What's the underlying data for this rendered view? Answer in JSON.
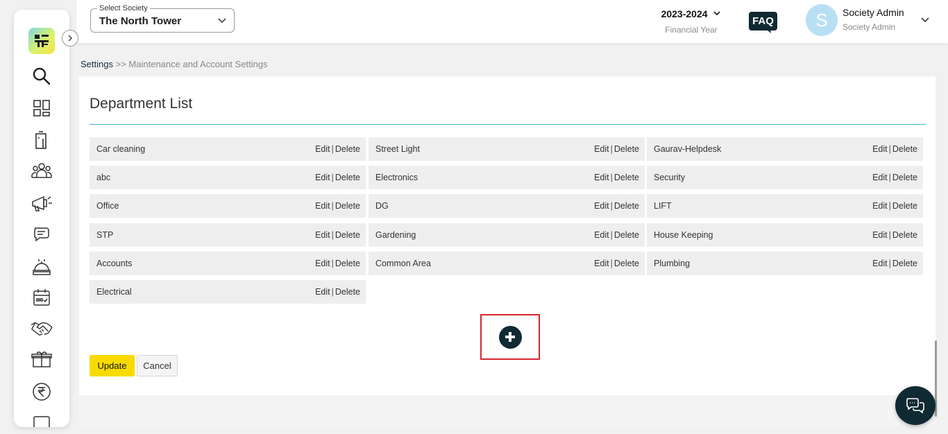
{
  "header": {
    "society_label": "Select Society",
    "society_value": "The North Tower",
    "financial_year_value": "2023-2024",
    "financial_year_label": "Financial Year",
    "faq_label": "FAQ",
    "avatar_initial": "S",
    "user_name": "Society Admin",
    "user_role": "Society Admin"
  },
  "breadcrumb": {
    "root": "Settings",
    "separator": ">>",
    "current": "Maintenance and Account Settings"
  },
  "page": {
    "title": "Department List",
    "edit_label": "Edit",
    "delete_label": "Delete",
    "pipe": "|",
    "update_label": "Update",
    "cancel_label": "Cancel"
  },
  "departments": [
    "Car cleaning",
    "Street Light",
    "Gaurav-Helpdesk",
    "abc",
    "Electronics",
    "Security",
    "Office",
    "DG",
    "LIFT",
    "STP",
    "Gardening",
    "House Keeping",
    "Accounts",
    "Common Area",
    "Plumbing",
    "Electrical"
  ],
  "sidebar": {
    "icons": [
      "search-icon",
      "dashboard-icon",
      "building-icon",
      "members-icon",
      "announcement-icon",
      "chat-icon",
      "amenities-icon",
      "calendar-icon",
      "handshake-icon",
      "package-icon",
      "rupee-icon",
      "more-icon"
    ]
  },
  "colors": {
    "accent": "#3fb3c9",
    "primary_dark": "#102a33",
    "update_button": "#f7db00",
    "highlight_box": "#d9252c"
  }
}
